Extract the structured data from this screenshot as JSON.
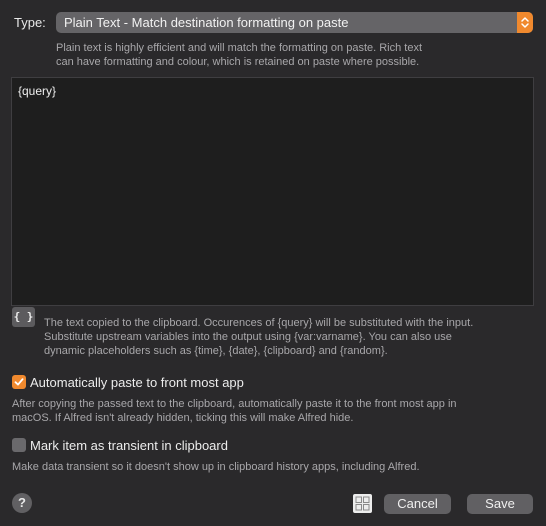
{
  "type_row": {
    "label": "Type:",
    "selected_value": "Plain Text - Match destination formatting on paste",
    "help_line1": "Plain text is highly efficient and will match the formatting on paste. Rich text",
    "help_line2": "can have formatting and colour, which is retained on paste where possible."
  },
  "editor": {
    "content": "{query}"
  },
  "placeholder_button": {
    "label": "{ }"
  },
  "query_help": {
    "line1": "The text copied to the clipboard. Occurences of {query} will be substituted with the input.",
    "line2": "Substitute upstream variables into the output using {var:varname}. You can also use",
    "line3": "dynamic placeholders such as {time}, {date}, {clipboard} and {random}."
  },
  "autopaste": {
    "checked": true,
    "label": "Automatically paste to front most app",
    "help_line1": "After copying the passed text to the clipboard, automatically paste it to the front most app in",
    "help_line2": "macOS. If Alfred isn't already hidden, ticking this will make Alfred hide."
  },
  "transient": {
    "checked": false,
    "label": "Mark item as transient in clipboard",
    "help_line1": "Make data transient so it doesn't show up in clipboard history apps, including Alfred."
  },
  "footer": {
    "help_label": "?",
    "cancel_label": "Cancel",
    "save_label": "Save"
  },
  "colors": {
    "accent": "#f0892e",
    "background": "#2a292b",
    "editor_background": "#1e1e1e",
    "control": "#616063"
  },
  "icons": {
    "select_stepper": "chevron-up-down-icon",
    "checkbox_checked": "checkmark-icon",
    "help": "question-mark-icon",
    "grid": "grid-icon"
  }
}
